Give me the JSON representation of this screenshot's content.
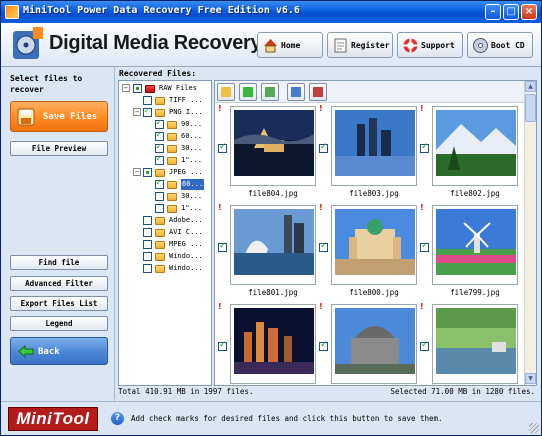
{
  "window": {
    "title": "MiniTool Power Data Recovery Free Edition v6.6"
  },
  "header": {
    "brand": "Digital Media Recovery",
    "nav": [
      {
        "label": "Home"
      },
      {
        "label": "Register"
      },
      {
        "label": "Support"
      },
      {
        "label": "Boot CD"
      }
    ]
  },
  "sidebar": {
    "heading": "Select files to recover",
    "save_label": "Save Files",
    "file_preview": "File Preview",
    "find_file": "Find file",
    "advanced_filter": "Advanced Filter",
    "export_files_list": "Export Files List",
    "legend": "Legend",
    "back": "Back"
  },
  "main": {
    "recovered_label": "Recovered Files:",
    "tree": [
      {
        "text": "RAW Files"
      },
      {
        "text": "TIFF ..."
      },
      {
        "text": "PNG I..."
      },
      {
        "text": "90..."
      },
      {
        "text": "60..."
      },
      {
        "text": "30..."
      },
      {
        "text": "1\"..."
      },
      {
        "text": "JPEG ..."
      },
      {
        "text": "60..."
      },
      {
        "text": "30..."
      },
      {
        "text": "1\"..."
      },
      {
        "text": "Adobe..."
      },
      {
        "text": "AVI C..."
      },
      {
        "text": "MPEG ..."
      },
      {
        "text": "Windo..."
      },
      {
        "text": "Windo..."
      }
    ],
    "tiles": [
      {
        "caption": "file804.jpg"
      },
      {
        "caption": "file803.jpg"
      },
      {
        "caption": "file802.jpg"
      },
      {
        "caption": "file801.jpg"
      },
      {
        "caption": "file800.jpg"
      },
      {
        "caption": "file799.jpg"
      },
      {
        "caption": ""
      },
      {
        "caption": ""
      },
      {
        "caption": ""
      }
    ],
    "recovery_mark": "!"
  },
  "status": {
    "total": "Total 410.91 MB in 1997 files.",
    "selected": "Selected 71.00 MB in 1280 files."
  },
  "footer": {
    "logo": "MiniTool",
    "hint": "Add check marks for desired files and click this button to save them."
  },
  "colors": {
    "accent_orange": "#ff8a20",
    "title_blue": "#0a5de0",
    "check_green": "#21a121"
  }
}
